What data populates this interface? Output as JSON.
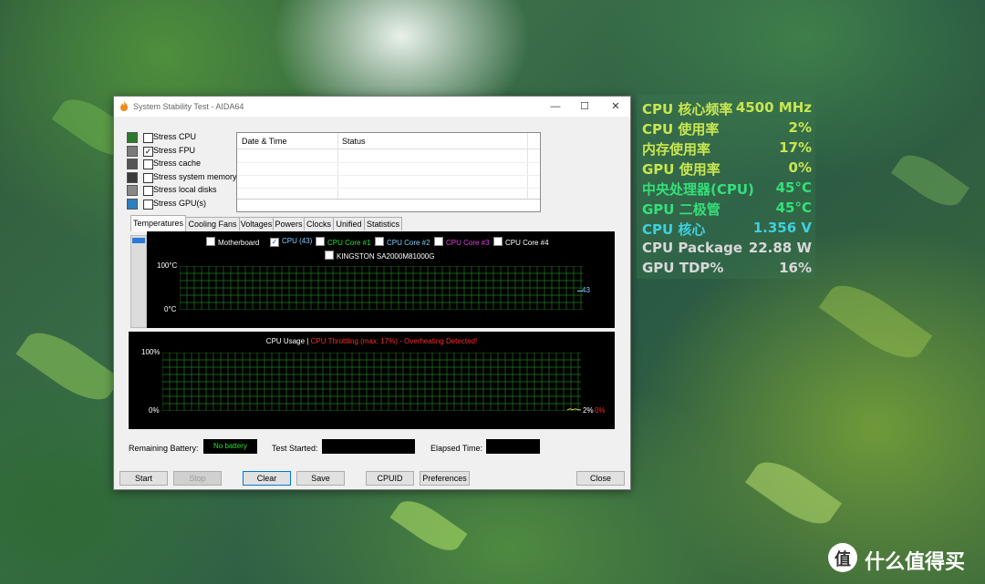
{
  "window": {
    "title": "System Stability Test - AIDA64",
    "controls": {
      "minimize": "—",
      "maximize": "☐",
      "close": "✕"
    }
  },
  "stress_options": [
    {
      "label": "Stress CPU",
      "checked": false,
      "icon": "cpu-chip-icon"
    },
    {
      "label": "Stress FPU",
      "checked": true,
      "icon": "fpu-icon"
    },
    {
      "label": "Stress cache",
      "checked": false,
      "icon": "cache-icon"
    },
    {
      "label": "Stress system memory",
      "checked": false,
      "icon": "memory-icon"
    },
    {
      "label": "Stress local disks",
      "checked": false,
      "icon": "disk-icon"
    },
    {
      "label": "Stress GPU(s)",
      "checked": false,
      "icon": "monitor-icon"
    }
  ],
  "log_table": {
    "columns": [
      "Date & Time",
      "Status"
    ],
    "rows": []
  },
  "tabs": [
    "Temperatures",
    "Cooling Fans",
    "Voltages",
    "Powers",
    "Clocks",
    "Unified",
    "Statistics"
  ],
  "active_tab": "Temperatures",
  "temperature_graph": {
    "legend": [
      {
        "label": "Motherboard",
        "checked": false,
        "color": "#ffffff"
      },
      {
        "label": "CPU (43)",
        "checked": true,
        "color": "#7fd0ff"
      },
      {
        "label": "CPU Core #1",
        "checked": false,
        "color": "#27e02b"
      },
      {
        "label": "CPU Core #2",
        "checked": false,
        "color": "#7fd0ff"
      },
      {
        "label": "CPU Core #3",
        "checked": false,
        "color": "#e040e0"
      },
      {
        "label": "CPU Core #4",
        "checked": false,
        "color": "#ffffff"
      },
      {
        "label": "KINGSTON SA2000M81000G",
        "checked": false,
        "color": "#ffffff"
      }
    ],
    "y_max_label": "100°C",
    "y_min_label": "0°C",
    "current_value_label": "43",
    "current_value": 43
  },
  "cpu_usage_graph": {
    "title": "CPU Usage",
    "separator": "|",
    "throttle_text": "CPU Throttling (max: 17%) - Overheating Detected!",
    "y_max_label": "100%",
    "y_min_label": "0%",
    "usage_label": "2%",
    "throttle_label": "0%",
    "usage_value": 2
  },
  "status": {
    "battery_label": "Remaining Battery:",
    "battery_value": "No battery",
    "test_started_label": "Test Started:",
    "test_started_value": "",
    "elapsed_label": "Elapsed Time:",
    "elapsed_value": ""
  },
  "buttons": {
    "start": "Start",
    "stop": "Stop",
    "clear": "Clear",
    "save": "Save",
    "cpuid": "CPUID",
    "preferences": "Preferences",
    "close": "Close"
  },
  "osd": [
    {
      "label": "CPU 核心频率",
      "value": "4500 MHz",
      "color": "#c8e650"
    },
    {
      "label": "CPU 使用率",
      "value": "2%",
      "color": "#c8e650"
    },
    {
      "label": "内存使用率",
      "value": "17%",
      "color": "#c8e650"
    },
    {
      "label": "GPU 使用率",
      "value": "0%",
      "color": "#c8e650"
    },
    {
      "label": "中央处理器(CPU)",
      "value": "45°C",
      "color": "#34e07a"
    },
    {
      "label": "GPU 二极管",
      "value": "45°C",
      "color": "#34e07a"
    },
    {
      "label": "CPU 核心",
      "value": "1.356 V",
      "color": "#3fd0e0"
    },
    {
      "label": "CPU Package",
      "value": "22.88 W",
      "color": "#d8d8d8"
    },
    {
      "label": "GPU TDP%",
      "value": "16%",
      "color": "#d8d8d8"
    }
  ],
  "brand": {
    "logo": "值",
    "text": "什么值得买"
  }
}
